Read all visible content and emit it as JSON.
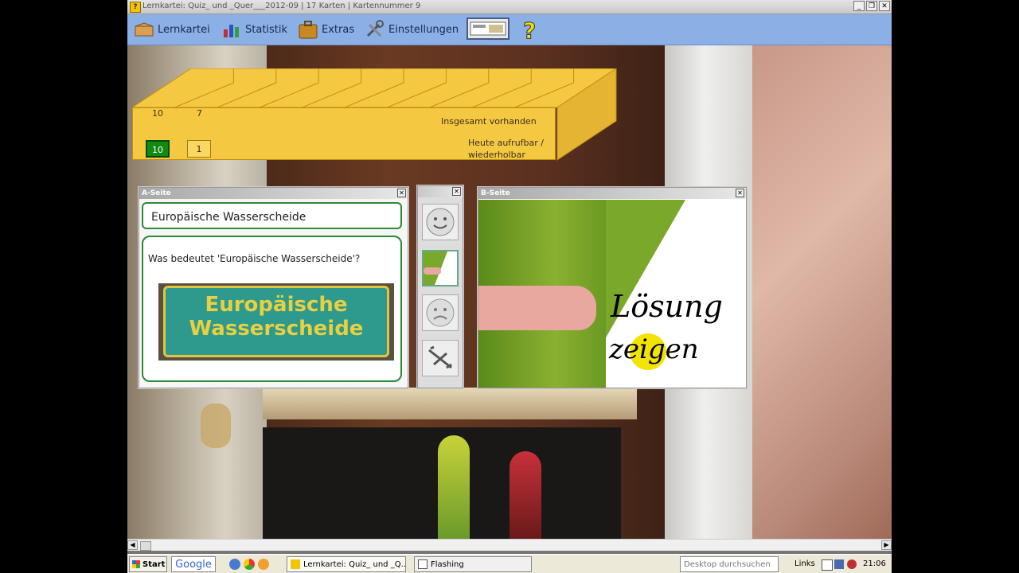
{
  "window": {
    "title": "Lernkartei: Quiz_ und _Quer___2012-09 | 17 Karten | Kartennummer 9",
    "app_icon": "?",
    "buttons": {
      "minimize": "_",
      "maximize": "❐",
      "close": "✕"
    }
  },
  "toolbar": {
    "lernkartei": "Lernkartei",
    "statistik": "Statistik",
    "extras": "Extras",
    "einstellungen": "Einstellungen",
    "help": "?"
  },
  "cardbox": {
    "total_label": "Insgesamt vorhanden",
    "due_label_1": "Heute aufrufbar /",
    "due_label_2": "wiederholbar",
    "compartments": [
      {
        "total": "10",
        "due": "10",
        "due_style": "green"
      },
      {
        "total": "7",
        "due": "1",
        "due_style": "yellow"
      }
    ],
    "compartment_count": 10
  },
  "a_side": {
    "header": "A-Seite",
    "term": "Europäische Wasserscheide",
    "question": "Was bedeutet 'Europäische Wasserscheide'?",
    "sign_line1": "Europäische",
    "sign_line2": "Wasserscheide"
  },
  "b_side": {
    "header": "B-Seite",
    "line1": "Lösung",
    "line2": "zeigen"
  },
  "taskbar": {
    "start": "Start",
    "google": "Google",
    "app1": "Lernkartei: Quiz_ und _Q...",
    "app2": "Flashing",
    "search_placeholder": "Desktop durchsuchen",
    "links": "Links",
    "clock": "21:06"
  },
  "colors": {
    "toolbar": "#8ab0e6",
    "box": "#f5c842",
    "green_frame": "#2a8a3a"
  }
}
